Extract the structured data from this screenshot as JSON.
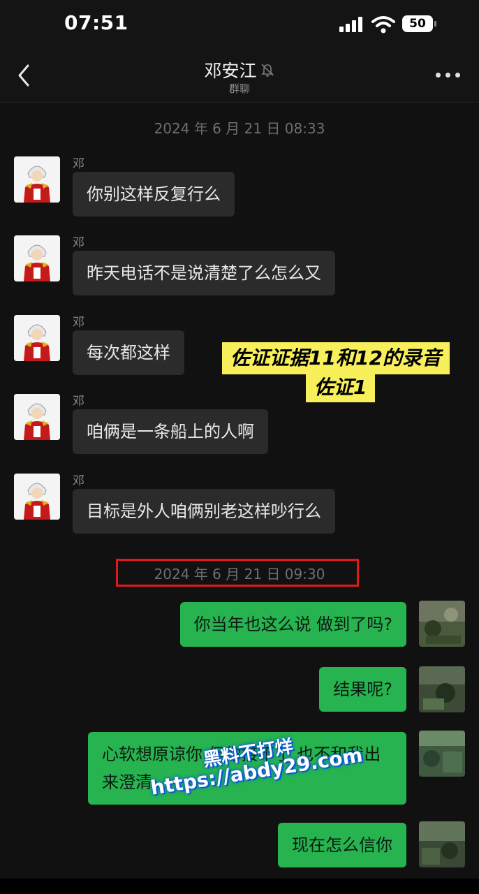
{
  "status_bar": {
    "time": "07:51",
    "battery": "50"
  },
  "header": {
    "title": "邓安江",
    "subtitle": "群聊"
  },
  "timestamps": [
    "2024 年 6 月 21 日 08:33",
    "2024 年 6 月 21 日 09:30"
  ],
  "incoming": [
    {
      "sender": "邓安江",
      "text": "你别这样反复行么"
    },
    {
      "sender": "邓安江",
      "text": "昨天电话不是说清楚了么怎么又"
    },
    {
      "sender": "邓安江",
      "text": "每次都这样"
    },
    {
      "sender": "邓安江",
      "text": "咱俩是一条船上的人啊"
    },
    {
      "sender": "邓安江",
      "text": "目标是外人咱俩别老这样吵行么"
    }
  ],
  "outgoing": [
    {
      "text": "你当年也这么说 做到了吗?"
    },
    {
      "text": "结果呢?"
    },
    {
      "text": "心软想原谅你 但你接不了 也不和我出来澄清"
    },
    {
      "text": "现在怎么信你"
    }
  ],
  "overlay": {
    "line1": "佐证证据11和12的录音",
    "line2": "佐证1"
  },
  "watermark": {
    "line1": "黑料不打烊",
    "line2": "https://abdy29.com"
  },
  "colors": {
    "background": "#111111",
    "incoming_bubble": "#2b2b2b",
    "outgoing_bubble": "#26b350",
    "highlight_box": "#e01a1a",
    "overlay_label": "#f8f05b"
  }
}
